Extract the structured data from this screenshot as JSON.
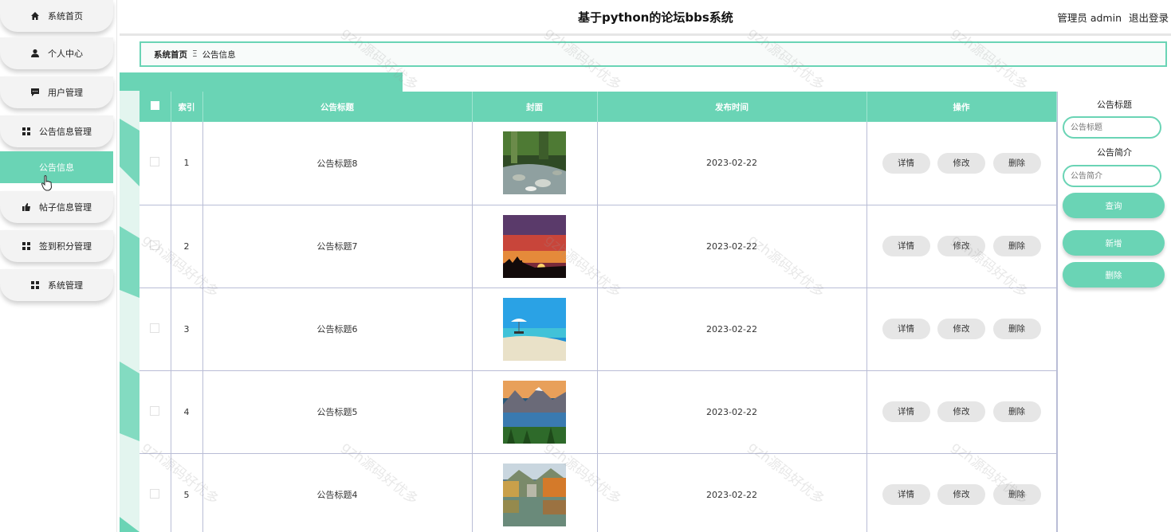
{
  "header": {
    "title": "基于python的论坛bbs系统",
    "admin": "管理员 admin",
    "logout": "退出登录"
  },
  "sidebar": {
    "items": [
      {
        "label": "系统首页",
        "icon": "home-icon"
      },
      {
        "label": "个人中心",
        "icon": "user-icon"
      },
      {
        "label": "用户管理",
        "icon": "chat-icon"
      },
      {
        "label": "公告信息管理",
        "icon": "grid-icon"
      },
      {
        "label": "帖子信息管理",
        "icon": "thumb-icon"
      },
      {
        "label": "签到积分管理",
        "icon": "grid-icon"
      },
      {
        "label": "系统管理",
        "icon": "grid-icon"
      }
    ],
    "active_sub": "公告信息"
  },
  "breadcrumb": {
    "home": "系统首页",
    "separator": "Ξ",
    "current": "公告信息"
  },
  "table": {
    "columns": [
      "索引",
      "公告标题",
      "封面",
      "发布时间",
      "操作"
    ],
    "rows": [
      {
        "index": "1",
        "title": "公告标题8",
        "date": "2023-02-22",
        "cover": "forest-stream"
      },
      {
        "index": "2",
        "title": "公告标题7",
        "date": "2023-02-22",
        "cover": "sunset"
      },
      {
        "index": "3",
        "title": "公告标题6",
        "date": "2023-02-22",
        "cover": "beach"
      },
      {
        "index": "4",
        "title": "公告标题5",
        "date": "2023-02-22",
        "cover": "mountain-lake"
      },
      {
        "index": "5",
        "title": "公告标题4",
        "date": "2023-02-22",
        "cover": "castle-lake"
      }
    ],
    "actions": {
      "detail": "详情",
      "edit": "修改",
      "delete": "删除"
    }
  },
  "search": {
    "title_label": "公告标题",
    "title_placeholder": "公告标题",
    "intro_label": "公告简介",
    "intro_placeholder": "公告简介",
    "query": "查询",
    "add": "新增",
    "delete": "删除"
  },
  "watermark": "gzh源码好优多",
  "colors": {
    "accent": "#6ad4b5",
    "border": "#b9bdd6"
  }
}
